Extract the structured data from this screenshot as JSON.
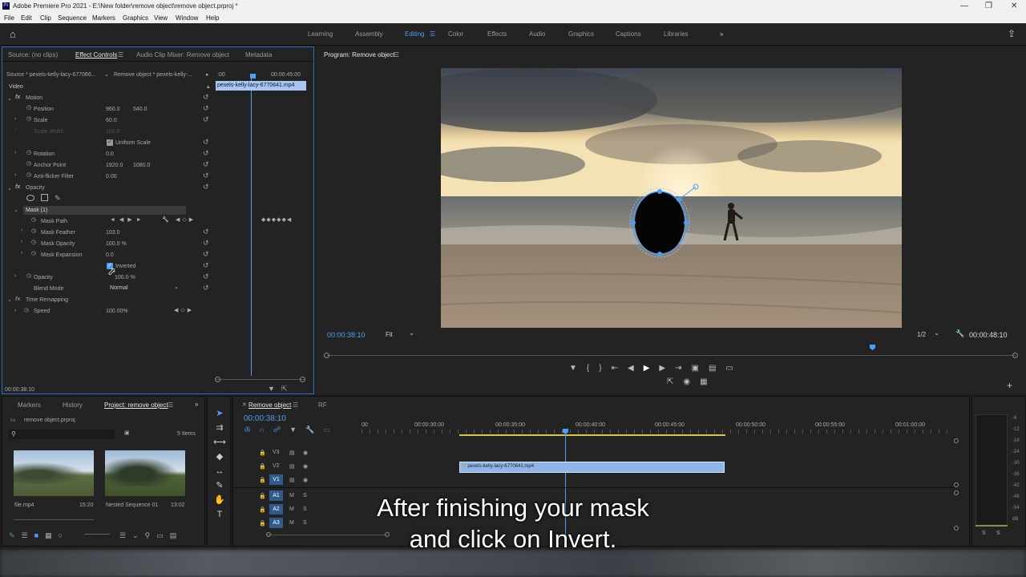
{
  "window": {
    "title": "Adobe Premiere Pro 2021 - E:\\New folder\\remove object\\remove object.prproj *",
    "logo": "Pr"
  },
  "menu": [
    "File",
    "Edit",
    "Clip",
    "Sequence",
    "Markers",
    "Graphics",
    "View",
    "Window",
    "Help"
  ],
  "workspaces": [
    "Learning",
    "Assembly",
    "Editing",
    "Color",
    "Effects",
    "Audio",
    "Graphics",
    "Captions",
    "Libraries"
  ],
  "active_workspace": "Editing",
  "source_panel": {
    "tabs": [
      "Source: (no clips)",
      "Effect Controls",
      "Audio Clip Mixer: Remove object",
      "Metadata"
    ],
    "source_label": "Source * pexels-kelly-lacy-677066...",
    "sequence_label": "Remove object * pexels-kelly-...",
    "timecode_start": ":00",
    "timecode_end": "00:00:45:00",
    "clip_name": "pexels-kelly-lacy-6770641.mp4",
    "video_label": "Video",
    "motion": "Motion",
    "position_label": "Position",
    "position_x": "960.0",
    "position_y": "540.0",
    "scale_label": "Scale",
    "scale_value": "60.0",
    "scale_width_label": "Scale Width",
    "scale_width_value": "100.0",
    "uniform_scale": "Uniform Scale",
    "rotation_label": "Rotation",
    "rotation_value": "0.0",
    "anchor_label": "Anchor Point",
    "anchor_x": "1920.0",
    "anchor_y": "1080.0",
    "antiflicker_label": "Anti-flicker Filter",
    "antiflicker_value": "0.00",
    "opacity_section": "Opacity",
    "mask_label": "Mask (1)",
    "mask_path": "Mask Path",
    "mask_feather": "Mask Feather",
    "mask_feather_value": "103.0",
    "mask_opacity": "Mask Opacity",
    "mask_opacity_value": "100.0 %",
    "mask_expansion": "Mask Expansion",
    "mask_expansion_value": "0.0",
    "inverted": "Inverted",
    "opacity_label": "Opacity",
    "opacity_value": "100.0 %",
    "blend_label": "Blend Mode",
    "blend_value": "Normal",
    "time_remap": "Time Remapping",
    "speed_label": "Speed",
    "speed_value": "100.00%",
    "timecode": "00:00:38:10"
  },
  "program": {
    "title": "Program: Remove object",
    "timecode": "00:00:38:10",
    "fit": "Fit",
    "quality": "1/2",
    "duration": "00:00:48:10"
  },
  "project": {
    "tabs": [
      "Markers",
      "History",
      "Project: remove object"
    ],
    "file": "remove object.prproj",
    "items_count": "5 Items",
    "thumbs": [
      {
        "name": "file.mp4",
        "dur": "15:20"
      },
      {
        "name": "Nested Sequence 01",
        "dur": "13:02"
      }
    ]
  },
  "timeline": {
    "tab": "Remove object",
    "tab2": "RF",
    "timecode": "00:00:38:10",
    "ruler": [
      "00",
      "00:00:30:00",
      "00:00:35:00",
      "00:00:40:00",
      "00:00:45:00",
      "00:00:50:00",
      "00:00:55:00",
      "00:01:00:00"
    ],
    "tracks": [
      "V3",
      "V2",
      "V1",
      "A1",
      "A2",
      "A3"
    ],
    "clip": "pexels-kelly-lacy-6770641.mp4"
  },
  "meter": {
    "labels": [
      "-6",
      "-12",
      "-18",
      "-24",
      "-30",
      "-36",
      "-42",
      "-48",
      "-54",
      "dB"
    ],
    "s1": "S",
    "s2": "S"
  },
  "subtitle": {
    "line1": "After finishing your mask",
    "line2": "and click on Invert."
  }
}
